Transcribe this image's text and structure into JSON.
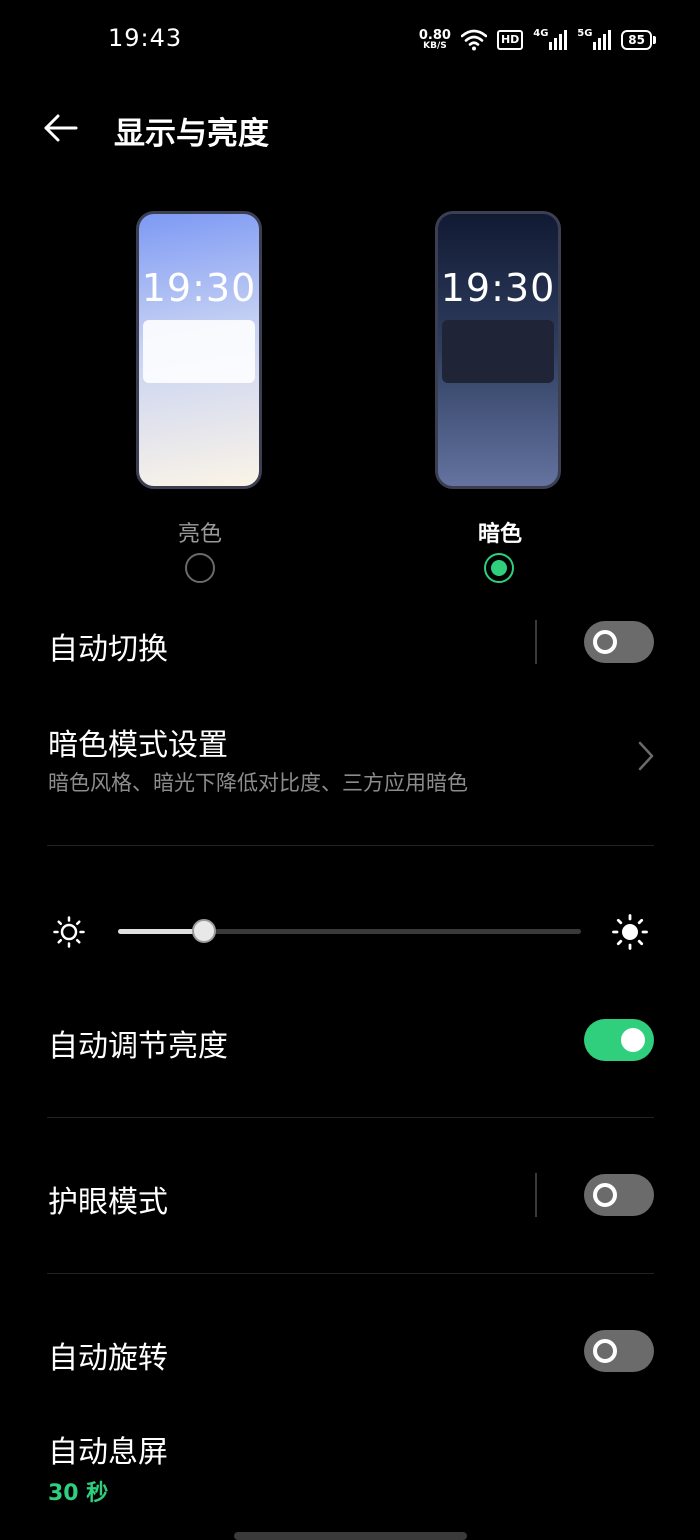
{
  "status_bar": {
    "time": "19:43",
    "net_speed": "0.80",
    "net_unit": "KB/S",
    "hd_label": "HD",
    "signal1_label": "4G",
    "signal2_label": "5G",
    "battery": "85"
  },
  "header": {
    "title": "显示与亮度",
    "back_icon": "arrow-left-icon"
  },
  "theme": {
    "light": {
      "preview_time": "19:30",
      "label": "亮色",
      "selected": false
    },
    "dark": {
      "preview_time": "19:30",
      "label": "暗色",
      "selected": true
    },
    "accent_color": "#2fcf7e"
  },
  "auto_switch": {
    "label": "自动切换",
    "enabled": false
  },
  "dark_mode_settings": {
    "label": "暗色模式设置",
    "subtitle": "暗色风格、暗光下降低对比度、三方应用暗色"
  },
  "brightness": {
    "level": 0.185
  },
  "auto_brightness": {
    "label": "自动调节亮度",
    "enabled": true
  },
  "eye_comfort": {
    "label": "护眼模式",
    "enabled": false
  },
  "auto_rotate": {
    "label": "自动旋转",
    "enabled": false
  },
  "screen_timeout": {
    "label": "自动息屏",
    "value": "30 秒"
  }
}
